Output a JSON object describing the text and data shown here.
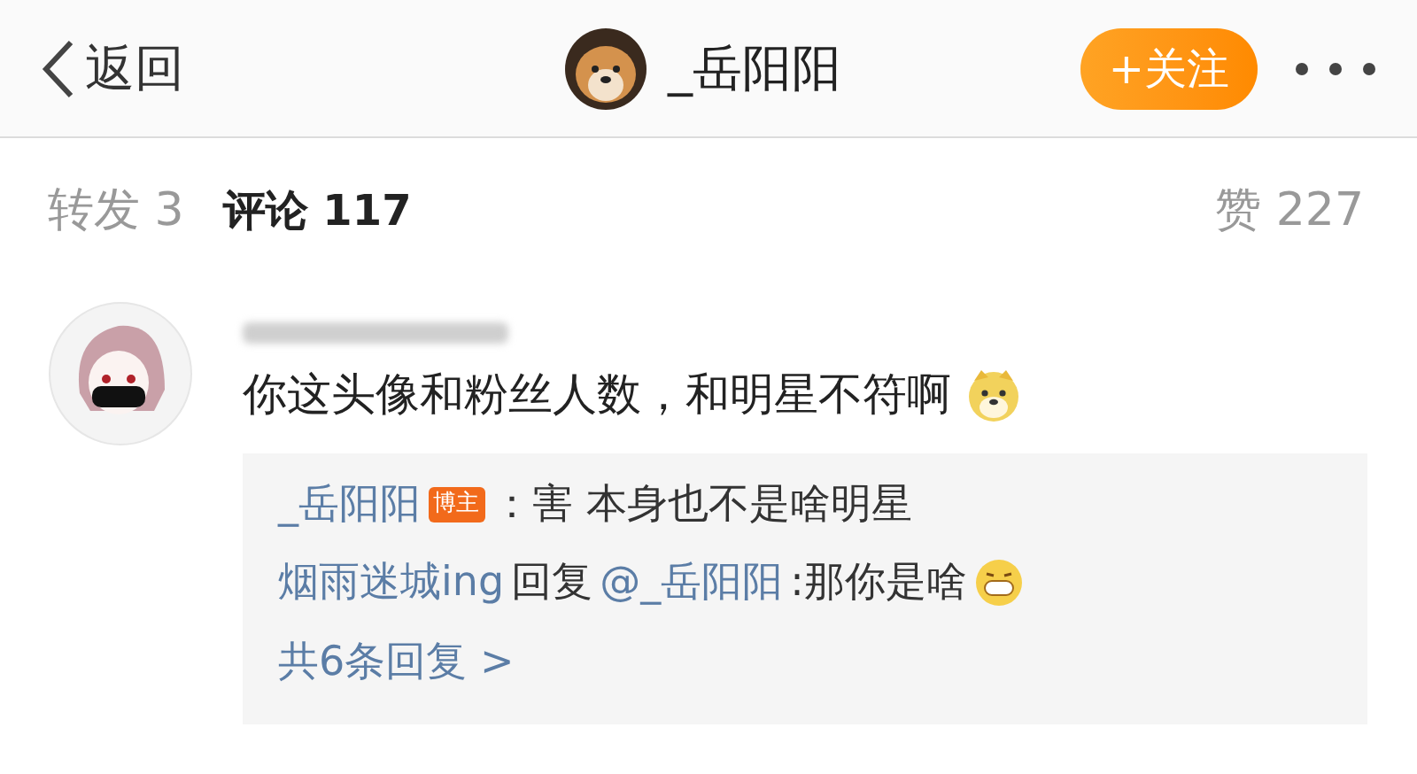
{
  "header": {
    "back": "返回",
    "username": "_岳阳阳",
    "follow_button": "+关注"
  },
  "tabs": [
    {
      "label": "转发 3",
      "selected": false
    },
    {
      "label": "评论 117",
      "selected": true
    }
  ],
  "likes": "赞 227",
  "comment": {
    "text": "你这头像和粉丝人数，和明星不符啊",
    "replies": [
      [
        {
          "kind": "link",
          "text": "_岳阳阳"
        },
        {
          "kind": "badge",
          "text": "博主"
        },
        {
          "kind": "text",
          "text": "：害 本身也不是啥明星"
        }
      ],
      [
        {
          "kind": "link",
          "text": "烟雨迷城ing"
        },
        {
          "kind": "text",
          "text": "回复"
        },
        {
          "kind": "link",
          "text": "@_岳阳阳"
        },
        {
          "kind": "text",
          "text": ":那你是啥"
        },
        {
          "kind": "grin"
        }
      ]
    ],
    "more": "共6条回复 >"
  }
}
